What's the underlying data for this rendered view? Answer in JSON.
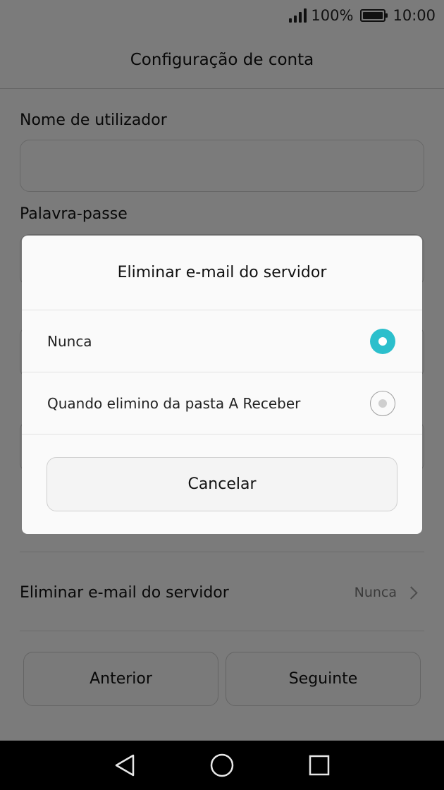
{
  "status_bar": {
    "battery_percent": "100%",
    "time": "10:00"
  },
  "header": {
    "title": "Configuração de conta"
  },
  "form": {
    "username_label": "Nome de utilizador",
    "username_value": "",
    "password_label": "Palavra-passe",
    "password_value": ""
  },
  "settings": {
    "delete_from_server_label": "Eliminar e-mail do servidor",
    "delete_from_server_value": "Nunca"
  },
  "footer": {
    "previous_label": "Anterior",
    "next_label": "Seguinte"
  },
  "dialog": {
    "title": "Eliminar e-mail do servidor",
    "options": [
      {
        "label": "Nunca",
        "selected": true
      },
      {
        "label": "Quando elimino da pasta A Receber",
        "selected": false
      }
    ],
    "cancel_label": "Cancelar"
  },
  "colors": {
    "accent": "#2bbfcc",
    "overlay": "rgba(0,0,0,0.5)"
  },
  "icons": {
    "nav_back": "back-triangle-icon",
    "nav_home": "home-circle-icon",
    "nav_recents": "recents-square-icon"
  }
}
